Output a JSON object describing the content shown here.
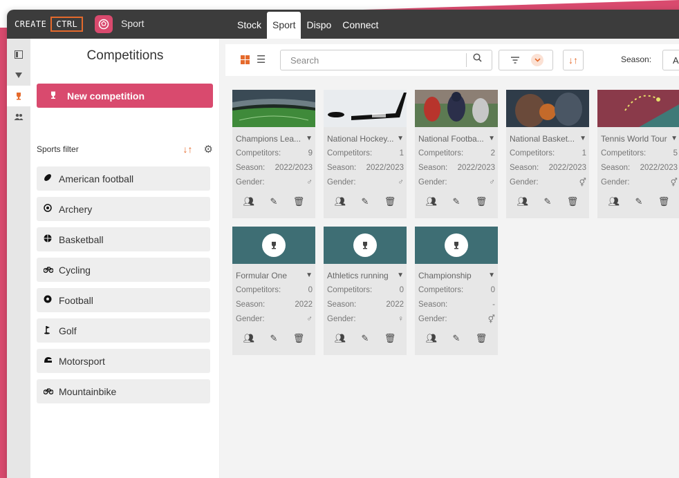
{
  "app": {
    "logo_left": "CREATE",
    "logo_right": "CTRL",
    "module_name": "Sport",
    "tabs": [
      "Stock",
      "Sport",
      "Dispo",
      "Connect"
    ],
    "active_tab": "Sport"
  },
  "sidebar": {
    "title": "Competitions",
    "new_button": "New competition",
    "filter_label": "Sports filter",
    "sports": [
      {
        "label": "American football",
        "icon": "american-football-icon"
      },
      {
        "label": "Archery",
        "icon": "archery-icon"
      },
      {
        "label": "Basketball",
        "icon": "basketball-icon"
      },
      {
        "label": "Cycling",
        "icon": "bicycle-icon"
      },
      {
        "label": "Football",
        "icon": "soccer-ball-icon"
      },
      {
        "label": "Golf",
        "icon": "golf-icon"
      },
      {
        "label": "Motorsport",
        "icon": "helmet-icon"
      },
      {
        "label": "Mountainbike",
        "icon": "bicycle-icon"
      }
    ]
  },
  "toolbar": {
    "search_placeholder": "Search",
    "season_label": "Season:",
    "season_value": "A"
  },
  "labels": {
    "competitors": "Competitors:",
    "season": "Season:",
    "gender": "Gender:"
  },
  "cards": [
    {
      "name": "Champions Lea...",
      "competitors": "9",
      "season": "2022/2023",
      "gender": "♂",
      "image": "stadium"
    },
    {
      "name": "National Hockey...",
      "competitors": "1",
      "season": "2022/2023",
      "gender": "♂",
      "image": "hockey"
    },
    {
      "name": "National Footba...",
      "competitors": "2",
      "season": "2022/2023",
      "gender": "♂",
      "image": "american-football"
    },
    {
      "name": "National Basket...",
      "competitors": "1",
      "season": "2022/2023",
      "gender": "⚥",
      "image": "basketball"
    },
    {
      "name": "Tennis World Tour",
      "competitors": "5",
      "season": "2022/2023",
      "gender": "⚥",
      "image": "tennis"
    },
    {
      "name": "Formular One",
      "competitors": "0",
      "season": "2022",
      "gender": "♂",
      "image": "trophy"
    },
    {
      "name": "Athletics running",
      "competitors": "0",
      "season": "2022",
      "gender": "♀",
      "image": "trophy"
    },
    {
      "name": "Championship",
      "competitors": "0",
      "season": "-",
      "gender": "⚥",
      "image": "trophy"
    }
  ],
  "colors": {
    "accent_pink": "#d94a6e",
    "accent_orange": "#e56a2c",
    "topbar": "#3c3c3c",
    "trophy_header": "#3e6e74"
  }
}
